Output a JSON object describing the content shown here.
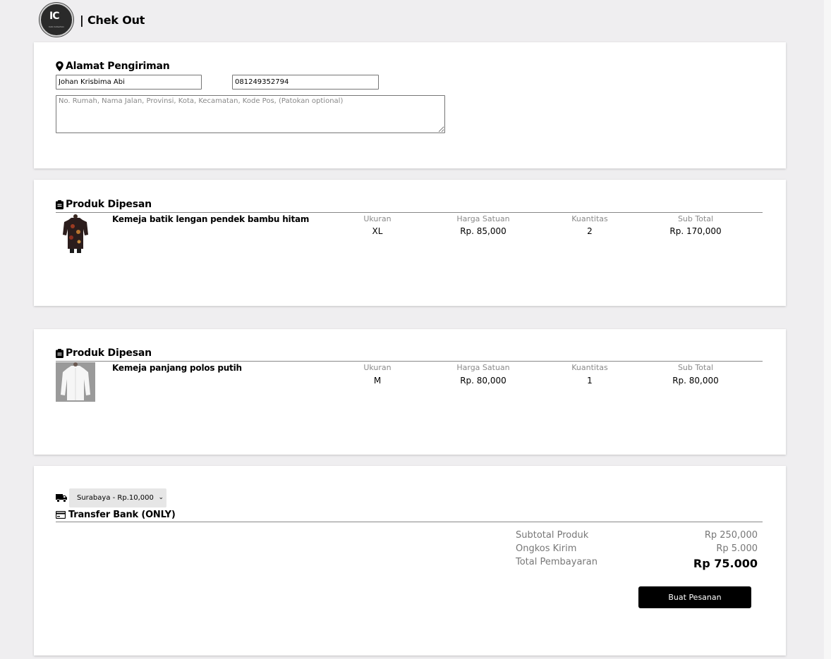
{
  "header": {
    "logo_mark": "IC",
    "logo_text": "Indo Collection",
    "title": "| Chek Out"
  },
  "address": {
    "title": "Alamat Pengiriman",
    "icon": "map-pin-icon",
    "name_value": "Johan Krisbima Abi",
    "phone_value": "081249352794",
    "address_placeholder": "No. Rumah, Nama Jalan, Provinsi, Kota, Kecamatan, Kode Pos, (Patokan optional)"
  },
  "columns": {
    "size": "Ukuran",
    "unit_price": "Harga Satuan",
    "quantity": "Kuantitas",
    "subtotal": "Sub Total"
  },
  "products": [
    {
      "section_title": "Produk Dipesan",
      "name": "Kemeja batik lengan pendek bambu hitam",
      "size": "XL",
      "unit_price": "Rp. 85,000",
      "quantity": "2",
      "subtotal": "Rp. 170,000"
    },
    {
      "section_title": "Produk Dipesan",
      "name": "Kemeja panjang polos putih",
      "size": "M",
      "unit_price": "Rp. 80,000",
      "quantity": "1",
      "subtotal": "Rp. 80,000"
    }
  ],
  "payment": {
    "shipping_selected": "Surabaya - Rp.10,000",
    "method": "Transfer Bank (ONLY)",
    "subtotal_label": "Subtotal Produk",
    "subtotal_value": "Rp 250,000",
    "shipping_label": "Ongkos Kirim",
    "shipping_value": "Rp 5.000",
    "total_label": "Total Pembayaran",
    "total_value": "Rp 75.000",
    "order_button": "Buat Pesanan"
  },
  "colors": {
    "background": "#efeef0",
    "card": "#ffffff",
    "button": "#000000",
    "muted_text": "#8a8a8a"
  }
}
